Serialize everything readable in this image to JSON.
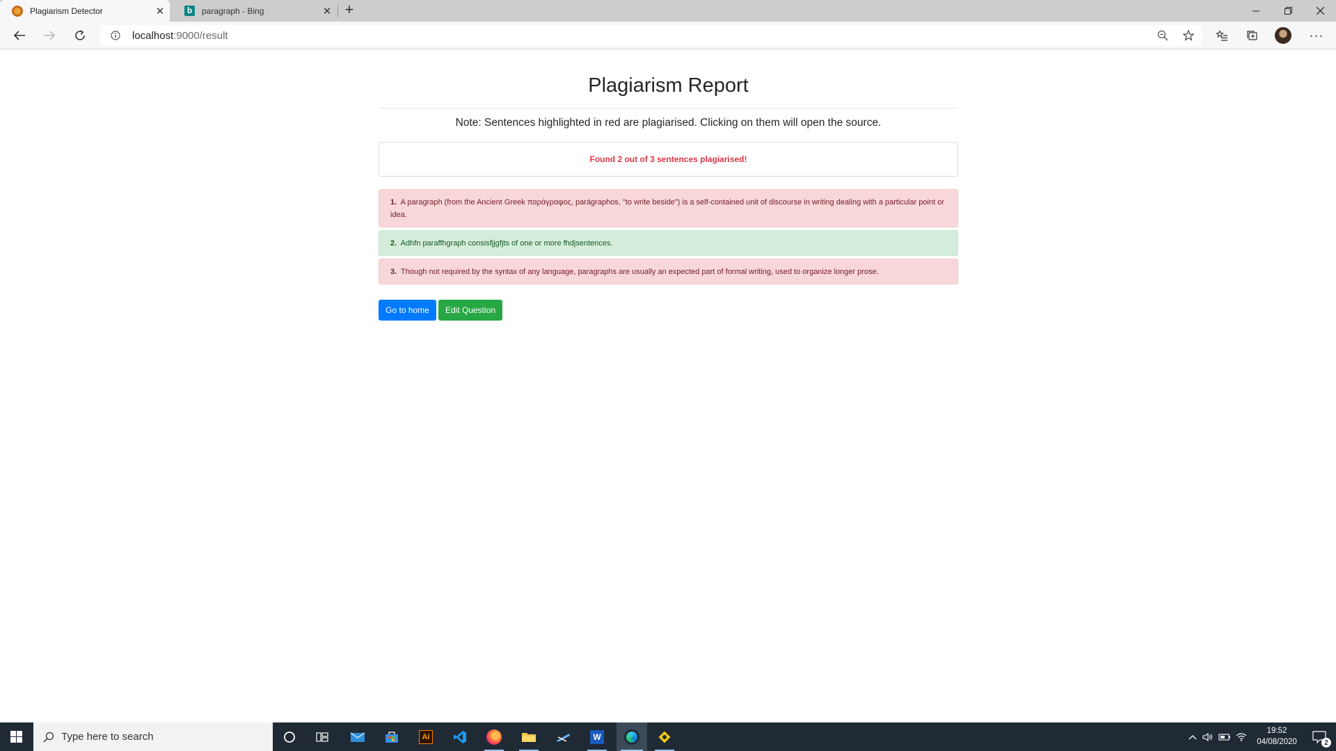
{
  "browser": {
    "tabs": [
      {
        "title": "Plagiarism Detector",
        "active": true,
        "favicon": "orange-circle-icon"
      },
      {
        "title": "paragraph - Bing",
        "active": false,
        "favicon": "bing-icon"
      }
    ],
    "address": {
      "host": "localhost",
      "path": ":9000/result"
    }
  },
  "page": {
    "title": "Plagiarism Report",
    "note": "Note: Sentences highlighted in red are plagiarised. Clicking on them will open the source.",
    "summary": "Found 2 out of 3 sentences plagiarised!",
    "sentences": [
      {
        "num": "1.",
        "text": "A paragraph (from the Ancient Greek παράγραφος, parágraphos, \"to write beside\") is a self-contained unit of discourse in writing dealing with a particular point or idea.",
        "plagiarised": true
      },
      {
        "num": "2.",
        "text": "Adhfn paraffhgraph consisfjjgfjts of one or more fhdjsentences.",
        "plagiarised": false
      },
      {
        "num": "3.",
        "text": "Though not required by the syntax of any language, paragraphs are usually an expected part of formal writing, used to organize longer prose.",
        "plagiarised": true
      }
    ],
    "buttons": {
      "home": "Go to home",
      "edit": "Edit Question"
    }
  },
  "taskbar": {
    "search_placeholder": "Type here to search",
    "time": "19:52",
    "date": "04/08/2020",
    "notification_count": "2"
  },
  "colors": {
    "plagiarised_bg": "#f8d7da",
    "original_bg": "#d4edda",
    "primary": "#007bff",
    "success": "#28a745",
    "danger": "#dc3545"
  }
}
